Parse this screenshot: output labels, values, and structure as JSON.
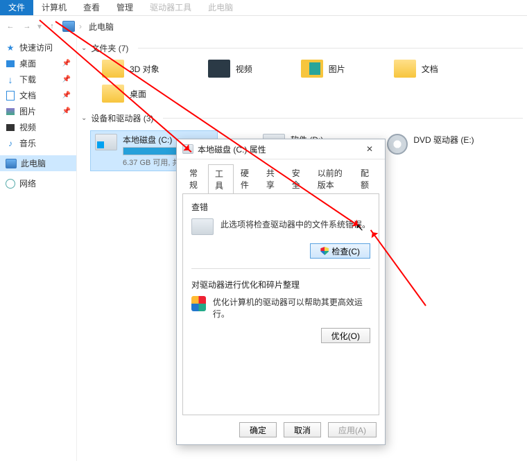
{
  "ribbon": {
    "file": "文件",
    "computer": "计算机",
    "view": "查看",
    "manage": "管理",
    "ghost1": "驱动器工具",
    "ghost2": "此电脑"
  },
  "breadcrumb": "此电脑",
  "sidebar": {
    "quick": "快速访问",
    "items": [
      {
        "label": "桌面"
      },
      {
        "label": "下载"
      },
      {
        "label": "文档"
      },
      {
        "label": "图片"
      },
      {
        "label": "视频"
      },
      {
        "label": "音乐"
      }
    ],
    "thispc": "此电脑",
    "network": "网络"
  },
  "groups": {
    "folders_hdr": "文件夹 (7)",
    "drives_hdr": "设备和驱动器 (3)",
    "f3d": "3D 对象",
    "fvideo": "视频",
    "fpic": "图片",
    "fdoc": "文档",
    "fdesktop": "桌面"
  },
  "drives": {
    "c": {
      "title": "本地磁盘 (C:)",
      "sub": "6.37 GB 可用, 共"
    },
    "d": {
      "title": "软件 (D:)"
    },
    "e": {
      "title": "DVD 驱动器 (E:)"
    }
  },
  "dialog": {
    "title": "本地磁盘 (C:) 属性",
    "tabs": {
      "general": "常规",
      "tools": "工具",
      "hardware": "硬件",
      "sharing": "共享",
      "security": "安全",
      "prev": "以前的版本",
      "quota": "配额"
    },
    "check_hdr": "查错",
    "check_text": "此选项将检查驱动器中的文件系统错误。",
    "check_btn": "检查(C)",
    "opt_hdr": "对驱动器进行优化和碎片整理",
    "opt_text": "优化计算机的驱动器可以帮助其更高效运行。",
    "opt_btn": "优化(O)",
    "ok": "确定",
    "cancel": "取消",
    "apply": "应用(A)"
  }
}
